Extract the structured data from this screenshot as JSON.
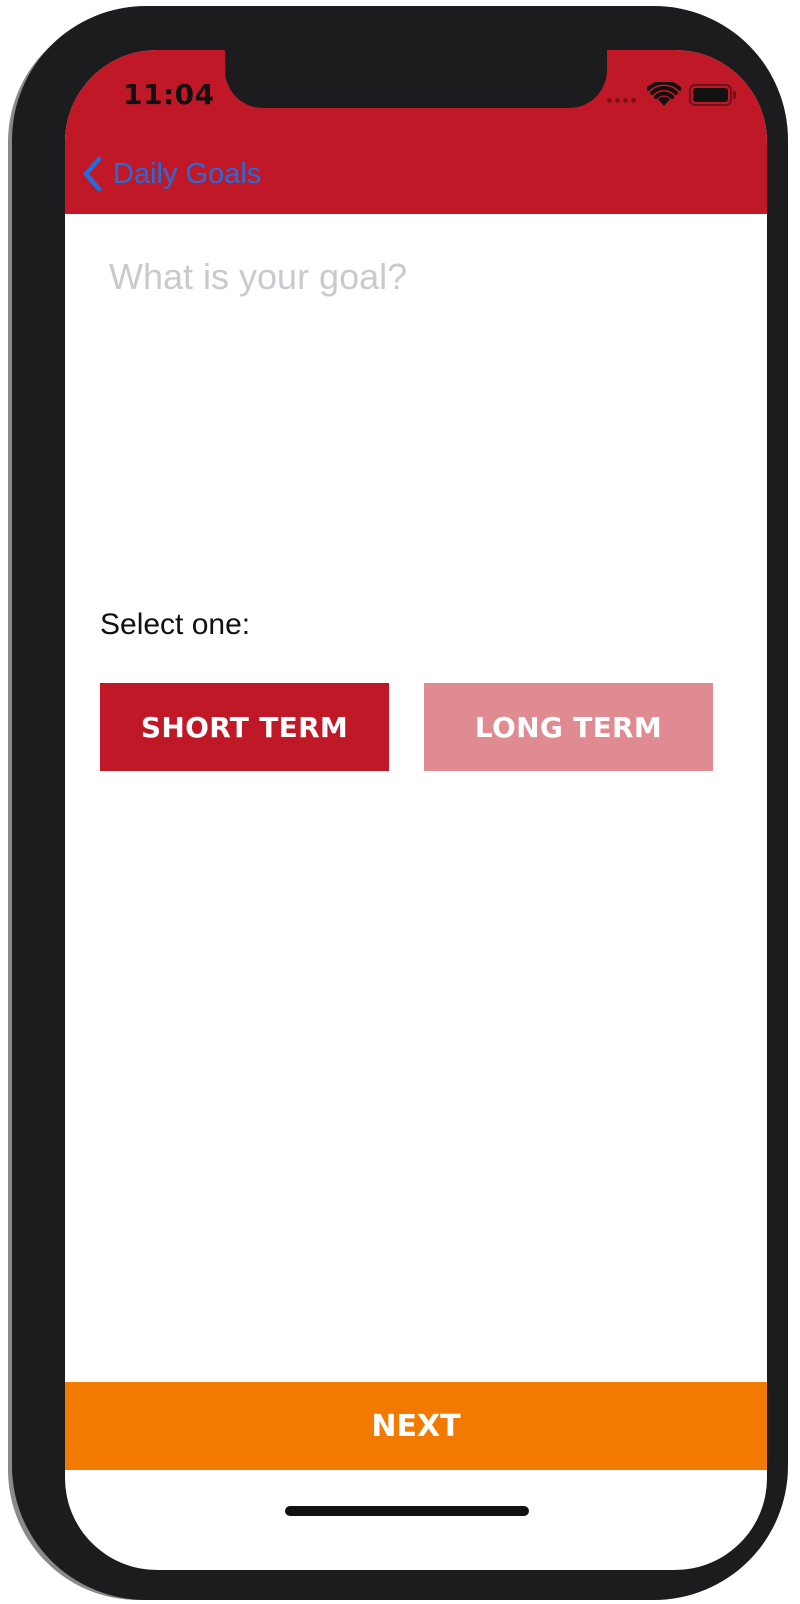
{
  "status_bar": {
    "time": "11:04"
  },
  "nav": {
    "back_label": "Daily Goals"
  },
  "goal_field": {
    "placeholder": "What is your goal?",
    "value": ""
  },
  "term_selection": {
    "prompt": "Select one:",
    "options": [
      {
        "label": "SHORT TERM",
        "selected": true
      },
      {
        "label": "LONG TERM",
        "selected": false
      }
    ]
  },
  "footer": {
    "next_label": "NEXT"
  },
  "colors": {
    "header": "#c01826",
    "selected_option": "#c01826",
    "unselected_option": "#e08a91",
    "next_button": "#f37a00",
    "back_link": "#1f6fe0"
  },
  "icons": {
    "back": "chevron-left-icon",
    "wifi": "wifi-icon",
    "battery": "battery-icon"
  }
}
